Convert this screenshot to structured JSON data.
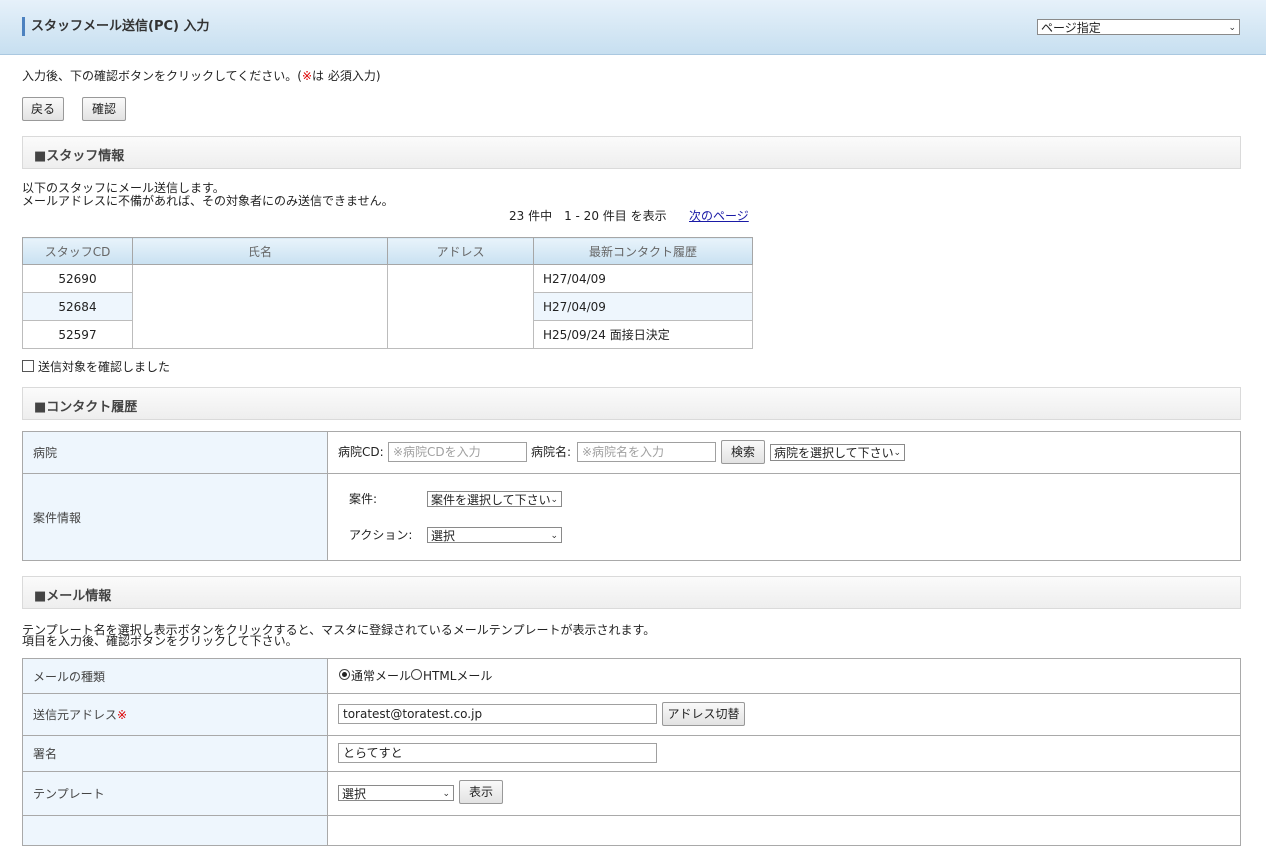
{
  "header": {
    "title": "スタッフメール送信(PC) 入力",
    "page_select": "ページ指定"
  },
  "intro": {
    "text": "入力後、下の確認ボタンをクリックしてください。(",
    "req_mark": "※",
    "text_after": "は 必須入力)",
    "back_label": "戻る",
    "confirm_label": "確認"
  },
  "staff_section": {
    "heading": "■スタッフ情報",
    "desc_line1": "以下のスタッフにメール送信します。",
    "desc_line2": "メールアドレスに不備があれば、その対象者にのみ送信できません。",
    "paging": "23 件中　1 - 20 件目 を表示",
    "next_page": "次のページ",
    "columns": [
      "スタッフCD",
      "氏名",
      "アドレス",
      "最新コンタクト履歴"
    ],
    "rows": [
      {
        "cd": "52690",
        "contact": "H27/04/09"
      },
      {
        "cd": "52684",
        "contact": "H27/04/09"
      },
      {
        "cd": "52597",
        "contact": "H25/09/24 面接日決定"
      }
    ],
    "confirm_check": "送信対象を確認しました"
  },
  "contact_section": {
    "heading": "■コンタクト履歴",
    "hospital_label": "病院",
    "hospital_cd_label": "病院CD:",
    "hospital_cd_placeholder": "※病院CDを入力",
    "hospital_name_label": "病院名:",
    "hospital_name_placeholder": "※病院名を入力",
    "search_label": "検索",
    "hospital_select": "病院を選択して下さい",
    "case_info_label": "案件情報",
    "case_label": "案件:",
    "case_select": "案件を選択して下さい",
    "action_label": "アクション:",
    "action_select": "選択"
  },
  "mail_section": {
    "heading": "■メール情報",
    "desc_line1": "テンプレート名を選択し表示ボタンをクリックすると、マスタに登録されているメールテンプレートが表示されます。",
    "desc_line2": "項目を入力後、確認ボタンをクリックして下さい。",
    "type_label": "メールの種類",
    "type_normal": "通常メール",
    "type_html": "HTMLメール",
    "from_label": "送信元アドレス",
    "from_req": "※",
    "from_value": "toratest@toratest.co.jp",
    "switch_label": "アドレス切替",
    "signature_label": "署名",
    "signature_value": "とらてすと",
    "template_label": "テンプレート",
    "template_select": "選択",
    "show_label": "表示"
  }
}
